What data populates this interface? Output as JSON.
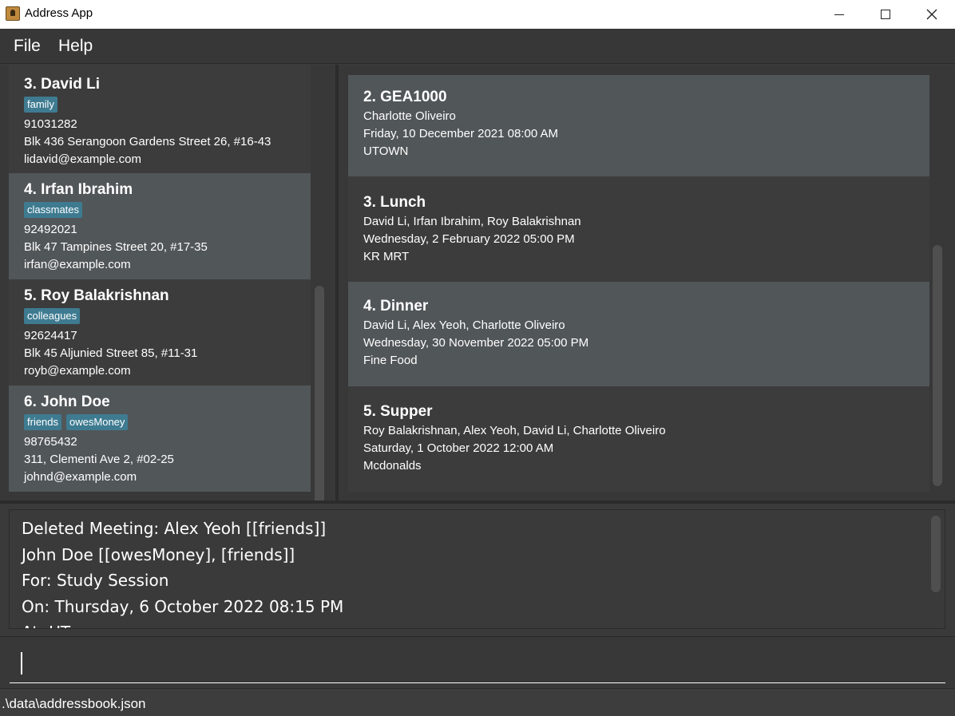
{
  "window": {
    "title": "Address App",
    "min_icon": "minimize-icon",
    "max_icon": "maximize-icon",
    "close_icon": "close-icon"
  },
  "menu": {
    "file": "File",
    "help": "Help"
  },
  "persons": [
    {
      "name": "3.  David Li",
      "tags": [
        "family"
      ],
      "phone": "91031282",
      "address": "Blk 436 Serangoon Gardens Street 26, #16-43",
      "email": "lidavid@example.com"
    },
    {
      "name": "4.  Irfan Ibrahim",
      "tags": [
        "classmates"
      ],
      "phone": "92492021",
      "address": "Blk 47 Tampines Street 20, #17-35",
      "email": "irfan@example.com"
    },
    {
      "name": "5.  Roy Balakrishnan",
      "tags": [
        "colleagues"
      ],
      "phone": "92624417",
      "address": "Blk 45 Aljunied Street 85, #11-31",
      "email": "royb@example.com"
    },
    {
      "name": "6.  John Doe",
      "tags": [
        "friends",
        "owesMoney"
      ],
      "phone": "98765432",
      "address": "311, Clementi Ave 2, #02-25",
      "email": "johnd@example.com"
    }
  ],
  "meetings": [
    {
      "title": "2.  GEA1000",
      "people": "Charlotte Oliveiro",
      "datetime": "Friday, 10 December 2021 08:00 AM",
      "location": "UTOWN"
    },
    {
      "title": "3.  Lunch",
      "people": "David Li, Irfan Ibrahim, Roy Balakrishnan",
      "datetime": "Wednesday, 2 February 2022 05:00 PM",
      "location": "KR MRT"
    },
    {
      "title": "4.  Dinner",
      "people": "David Li, Alex Yeoh, Charlotte Oliveiro",
      "datetime": "Wednesday, 30 November 2022 05:00 PM",
      "location": "Fine Food"
    },
    {
      "title": "5.  Supper",
      "people": "Roy Balakrishnan, Alex Yeoh, David Li, Charlotte Oliveiro",
      "datetime": "Saturday, 1 October 2022 12:00 AM",
      "location": "Mcdonalds"
    }
  ],
  "result": {
    "lines": [
      "Deleted Meeting: Alex Yeoh [[friends]]",
      "John Doe [[owesMoney], [friends]]",
      "For: Study Session",
      "On: Thursday, 6 October 2022 08:15 PM",
      "At: UT"
    ]
  },
  "command": {
    "value": ""
  },
  "status": {
    "path": ".\\data\\addressbook.json"
  }
}
